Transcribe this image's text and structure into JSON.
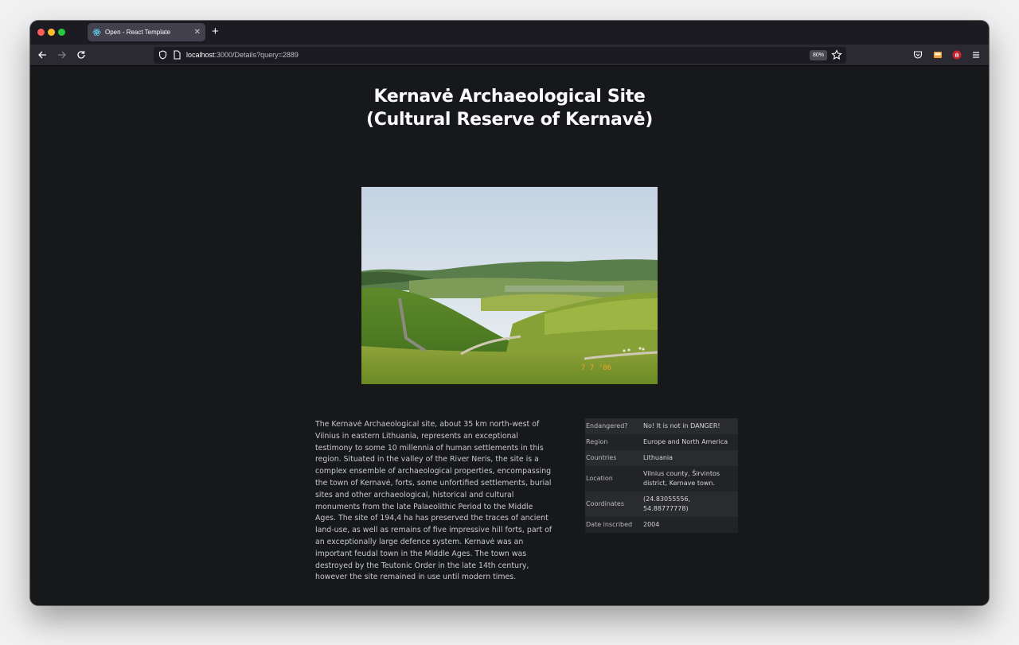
{
  "browser": {
    "tab_title": "Open - React Template",
    "url_host": "localhost",
    "url_rest": ":3000/Details?query=2889",
    "zoom": "80%"
  },
  "page": {
    "title": "Kernavė Archaeological Site (Cultural Reserve of Kernavė)",
    "photo_caption": "7 7 '06",
    "description": "The Kernavė Archaeological site, about 35 km north-west of Vilnius in eastern Lithuania, represents an exceptional testimony to some 10 millennia of human settlements in this region. Situated in the valley of the River Neris, the site is a complex ensemble of archaeological properties, encompassing the town of Kernavė, forts, some unfortified settlements, burial sites and other archaeological, historical and cultural monuments from the late Palaeolithic Period to the Middle Ages. The site of 194,4 ha has preserved the traces of ancient land-use, as well as remains of five impressive hill forts, part of an exceptionally large defence system. Kernavė was an important feudal town in the Middle Ages. The town was destroyed by the Teutonic Order in the late 14th century, however the site remained in use until modern times.",
    "info": [
      {
        "key": "Endangered?",
        "value": "No! It is not in DANGER!"
      },
      {
        "key": "Region",
        "value": "Europe and North America"
      },
      {
        "key": "Countries",
        "value": "Lithuania"
      },
      {
        "key": "Location",
        "value": "Vilnius county, Širvintos district, Kernave town."
      },
      {
        "key": "Coordinates",
        "value": "(24.83055556, 54.88777778)"
      },
      {
        "key": "Date inscribed",
        "value": "2004"
      }
    ]
  },
  "colors": {
    "page_bg": "#17181a",
    "tab_bar": "#1c1b22",
    "nav_bar": "#2b2a33",
    "accent_red": "#fe5f57",
    "accent_yellow": "#febc2e",
    "accent_green": "#28c840"
  }
}
